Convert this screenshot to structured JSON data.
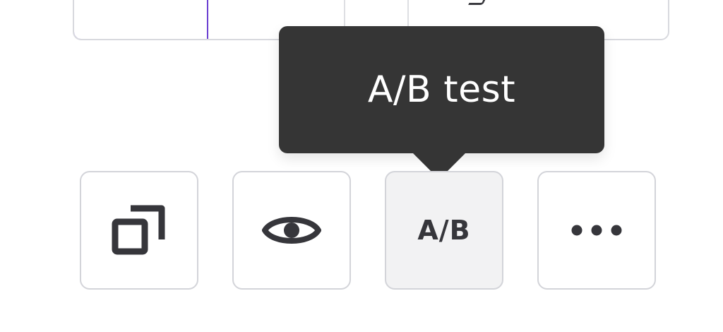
{
  "tooltip": {
    "text": "A/B test"
  },
  "toolbar": {
    "items": [
      {
        "id": "duplicate",
        "icon": "duplicate-icon"
      },
      {
        "id": "preview",
        "icon": "eye-icon"
      },
      {
        "id": "ab-test",
        "label": "A/B",
        "icon": "ab-test-icon",
        "active": true
      },
      {
        "id": "more",
        "icon": "more-horizontal-icon"
      }
    ]
  },
  "colors": {
    "tooltip_bg": "#353535",
    "icon": "#36363b",
    "border": "#d3d4d9",
    "active_bg": "#f2f2f3",
    "selected_outline": "#6b3fd1"
  }
}
